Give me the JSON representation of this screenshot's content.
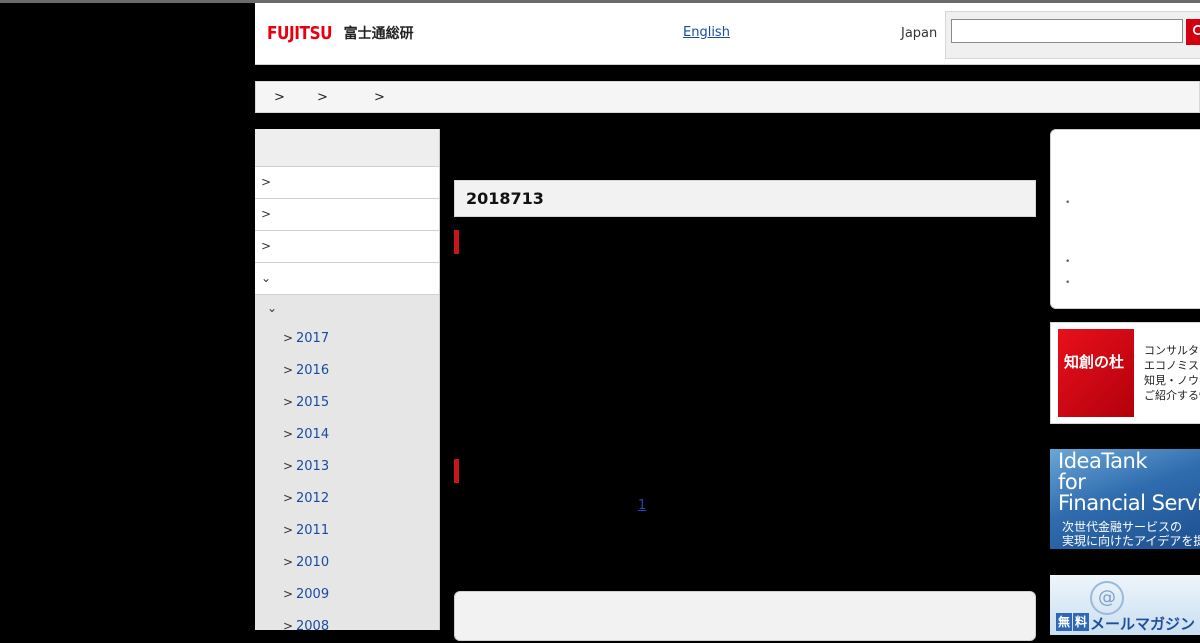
{
  "header": {
    "logo_brand": "FUJITSU",
    "logo_japanese": "富士通総研",
    "language_link": "English",
    "region": "Japan",
    "search_placeholder": "",
    "search_icon": "search-icon"
  },
  "breadcrumb": {
    "separators": [
      ">",
      ">",
      ">"
    ]
  },
  "leftnav": {
    "chevron_right": ">",
    "chevron_down": "⌄",
    "years": [
      "2017",
      "2016",
      "2015",
      "2014",
      "2013",
      "2012",
      "2011",
      "2010",
      "2009",
      "2008"
    ]
  },
  "main": {
    "title": "2018713",
    "page_link": "1"
  },
  "right": {
    "bullet": "•",
    "banner1": {
      "title": "知創の杜",
      "lines": [
        "コンサルタン",
        "エコノミス",
        "知見・ノウハ",
        "ご紹介する情"
      ]
    },
    "banner2": {
      "lines": [
        "IdeaTank",
        "for",
        "Financial Servic"
      ],
      "sub_lines": [
        "次世代金融サービスの",
        "実現に向けたアイデアを提"
      ]
    },
    "banner3": {
      "tag1": "無",
      "tag2": "料",
      "text": "メールマガジン"
    }
  },
  "colors": {
    "brand_red": "#e60012",
    "link_blue": "#1a4ba0",
    "accent_bar": "#c8161d"
  }
}
